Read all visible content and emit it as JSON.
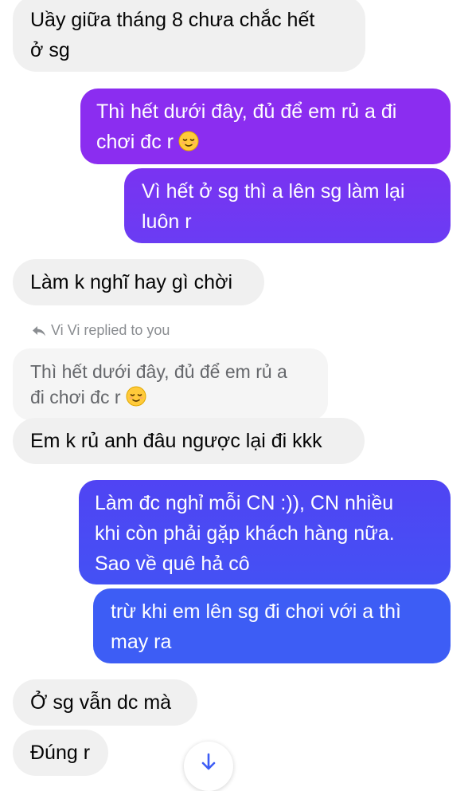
{
  "colors": {
    "incoming_bubble": "#f0f0f0",
    "outgoing_purple": "#8b2df0",
    "outgoing_blue": "#3d5df5",
    "muted_text": "#8a8d91"
  },
  "messages": [
    {
      "sender": "them",
      "text": "Uầy giữa tháng 8 chưa chắc hết\nở sg"
    },
    {
      "sender": "me",
      "text": "Thì hết dưới đây, đủ để em rủ a đi\nchơi đc r",
      "emoji": "relieved-face"
    },
    {
      "sender": "me",
      "text": "Vì hết ở sg thì a lên sg làm lại\nluôn r"
    },
    {
      "sender": "them",
      "text": "Làm k nghĩ hay gì chời"
    },
    {
      "sender": "them",
      "text": "Em k rủ anh đâu ngược lại đi kkk"
    },
    {
      "sender": "me",
      "text": "Làm đc nghỉ mỗi CN :)), CN nhiều\nkhi còn phải gặp khách hàng nữa.\nSao về quê hả cô"
    },
    {
      "sender": "me",
      "text": "trừ khi em lên sg đi chơi với a thì\nmay ra"
    },
    {
      "sender": "them",
      "text": "Ở sg vẫn dc mà"
    },
    {
      "sender": "them",
      "text": "Đúng r"
    }
  ],
  "reply": {
    "label": "Vi Vi replied to you",
    "icon": "reply-arrow-icon",
    "quoted_text": "Thì hết dưới đây, đủ để em rủ a\nđi chơi đc r",
    "quoted_emoji": "relieved-face"
  },
  "scroll_button": {
    "icon": "arrow-down-icon"
  }
}
